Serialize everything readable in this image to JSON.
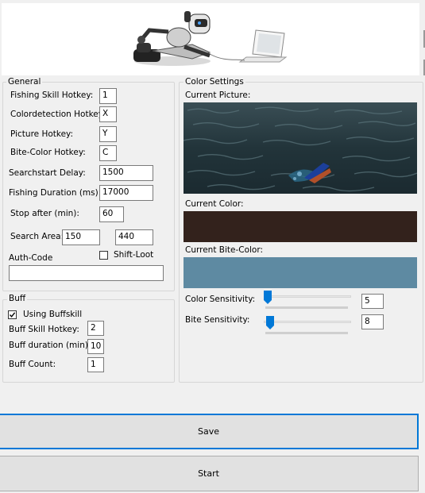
{
  "banner": {
    "image": "robot-with-laptop-illustration"
  },
  "general": {
    "title": "General",
    "fishing_skill_hotkey": {
      "label": "Fishing Skill Hotkey:",
      "value": "1"
    },
    "colordetection_hotkey": {
      "label": "Colordetection Hotkey:",
      "value": "X"
    },
    "picture_hotkey": {
      "label": "Picture Hotkey:",
      "value": "Y"
    },
    "bite_color_hotkey": {
      "label": "Bite-Color Hotkey:",
      "value": "C"
    },
    "searchstart_delay": {
      "label": "Searchstart Delay:",
      "value": "1500"
    },
    "fishing_duration": {
      "label": "Fishing Duration (ms):",
      "value": "17000"
    },
    "stop_after": {
      "label": "Stop after (min):",
      "value": "60"
    },
    "search_area": {
      "label": "Search Area:",
      "value_x": "150",
      "value_y": "440"
    },
    "auth_code": {
      "label": "Auth-Code",
      "value": ""
    },
    "shift_loot": {
      "label": "Shift-Loot",
      "checked": false
    }
  },
  "buff": {
    "title": "Buff",
    "using_buffskill": {
      "label": "Using Buffskill",
      "checked": true
    },
    "buff_skill_hotkey": {
      "label": "Buff Skill Hotkey:",
      "value": "2"
    },
    "buff_duration": {
      "label": "Buff duration (min):",
      "value": "10"
    },
    "buff_count": {
      "label": "Buff Count:",
      "value": "1"
    }
  },
  "color_settings": {
    "title": "Color Settings",
    "current_picture_label": "Current Picture:",
    "current_color_label": "Current Color:",
    "current_color": "#33221c",
    "current_bite_color_label": "Current Bite-Color:",
    "current_bite_color": "#5e8aa2",
    "color_sensitivity": {
      "label": "Color Sensitivity:",
      "value": "5",
      "level": 5
    },
    "bite_sensitivity": {
      "label": "Bite Sensitivity:",
      "value": "8",
      "level": 8
    }
  },
  "buttons": {
    "save": "Save",
    "start": "Start"
  },
  "colors": {
    "accent": "#0078d7",
    "window_bg": "#f0f0f0",
    "button_bg": "#e1e1e1"
  }
}
